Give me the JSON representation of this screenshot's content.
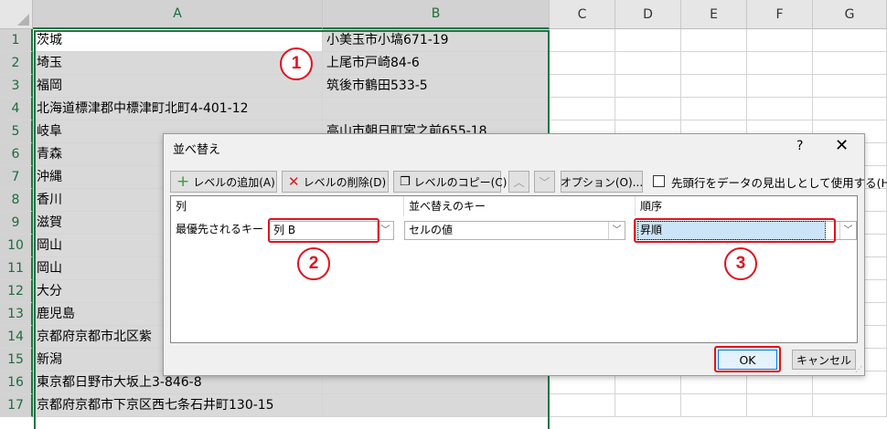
{
  "spreadsheet": {
    "columns": [
      "A",
      "B",
      "C",
      "D",
      "E",
      "F",
      "G"
    ],
    "rows": [
      {
        "num": "1",
        "a": "茨城",
        "b": "小美玉市小塙671-19"
      },
      {
        "num": "2",
        "a": "埼玉",
        "b": "上尾市戸崎84-6"
      },
      {
        "num": "3",
        "a": "福岡",
        "b": "筑後市鶴田533-5"
      },
      {
        "num": "4",
        "a": "北海道標津郡中標津町北町4-401-12",
        "b": ""
      },
      {
        "num": "5",
        "a": "岐阜",
        "b": "高山市朝日町宮之前655-18"
      },
      {
        "num": "6",
        "a": "青森",
        "b": ""
      },
      {
        "num": "7",
        "a": "沖縄",
        "b": ""
      },
      {
        "num": "8",
        "a": "香川",
        "b": ""
      },
      {
        "num": "9",
        "a": "滋賀",
        "b": ""
      },
      {
        "num": "10",
        "a": "岡山",
        "b": ""
      },
      {
        "num": "11",
        "a": "岡山",
        "b": ""
      },
      {
        "num": "12",
        "a": "大分",
        "b": ""
      },
      {
        "num": "13",
        "a": "鹿児島",
        "b": ""
      },
      {
        "num": "14",
        "a": "京都府京都市北区紫",
        "b": ""
      },
      {
        "num": "15",
        "a": "新潟",
        "b": ""
      },
      {
        "num": "16",
        "a": "東京都日野市大坂上3-846-8",
        "b": ""
      },
      {
        "num": "17",
        "a": "京都府京都市下京区西七条石井町130-15",
        "b": ""
      }
    ]
  },
  "annotations": {
    "one": "1",
    "two": "2",
    "three": "3"
  },
  "dialog": {
    "title": "並べ替え",
    "help": "?",
    "close": "✕",
    "toolbar": {
      "add_level": "レベルの追加(A)",
      "delete_level": "レベルの削除(D)",
      "copy_level": "レベルのコピー(C)",
      "options": "オプション(O)...",
      "header_checkbox_label": "先頭行をデータの見出しとして使用する(H)"
    },
    "grid_headers": {
      "column": "列",
      "sort_on": "並べ替えのキー",
      "order": "順序"
    },
    "row": {
      "label": "最優先されるキー",
      "column_value": "列 B",
      "sort_on_value": "セルの値",
      "order_value": "昇順"
    },
    "ok": "OK",
    "cancel": "キャンセル"
  },
  "colors": {
    "excel_green": "#217346",
    "highlight_red": "#e0111f",
    "selection_gray": "#d9d9d9"
  },
  "icons": [
    "plus-icon",
    "x-delete-icon",
    "copy-icon",
    "chevron-up-icon",
    "chevron-down-icon",
    "dropdown-arrow-icon",
    "close-icon",
    "help-icon"
  ]
}
